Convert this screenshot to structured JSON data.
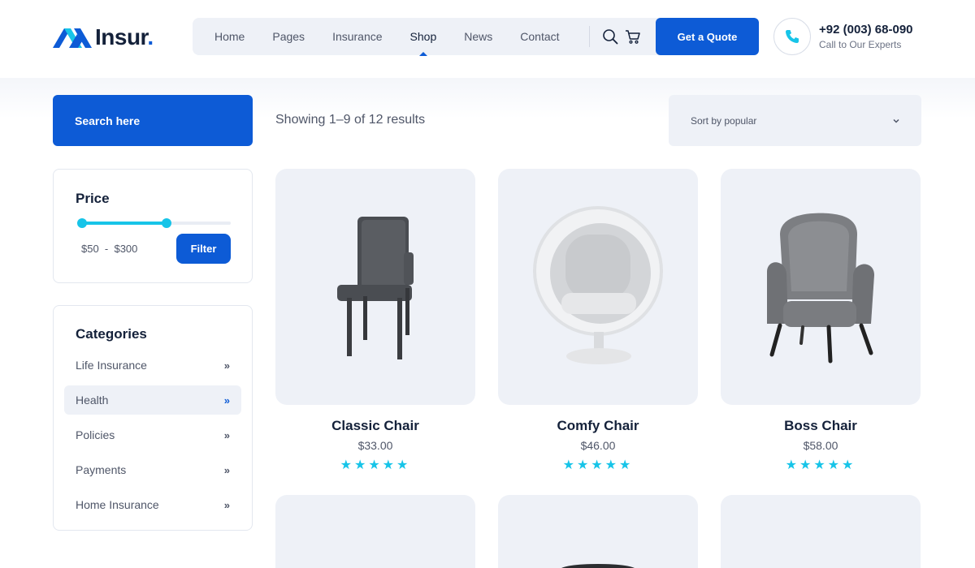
{
  "brand": {
    "name": "Insur",
    "dot": ".",
    "accent": "#0d5bd6"
  },
  "nav": {
    "items": [
      {
        "label": "Home"
      },
      {
        "label": "Pages"
      },
      {
        "label": "Insurance"
      },
      {
        "label": "Shop",
        "active": true
      },
      {
        "label": "News"
      },
      {
        "label": "Contact"
      }
    ],
    "icons": [
      "search-icon",
      "cart-icon"
    ],
    "cta_label": "Get a Quote"
  },
  "contact": {
    "phone": "+92 (003) 68-090",
    "caption": "Call to Our Experts",
    "icon": "phone-icon"
  },
  "sidebar": {
    "search_label": "Search here",
    "price": {
      "title": "Price",
      "range_text": "$50  -  $300",
      "slider_low": 0.0,
      "slider_high": 0.57,
      "filter_label": "Filter"
    },
    "categories": {
      "title": "Categories",
      "items": [
        {
          "label": "Life Insurance",
          "chevron": "»"
        },
        {
          "label": "Health",
          "chevron": "»",
          "active": true
        },
        {
          "label": "Policies",
          "chevron": "»"
        },
        {
          "label": "Payments",
          "chevron": "»"
        },
        {
          "label": "Home Insurance",
          "chevron": "»"
        }
      ]
    }
  },
  "shop": {
    "result_text": "Showing 1–9 of 12 results",
    "sort_label": "Sort by popular",
    "sort_icon": "chevron-down-icon",
    "products": [
      {
        "name": "Classic Chair",
        "price": "$33.00",
        "rating": 5,
        "stars": "★★★★★"
      },
      {
        "name": "Comfy Chair",
        "price": "$46.00",
        "rating": 5,
        "stars": "★★★★★"
      },
      {
        "name": "Boss Chair",
        "price": "$58.00",
        "rating": 5,
        "stars": "★★★★★"
      }
    ]
  },
  "colors": {
    "primary": "#0d5bd6",
    "cyan": "#17c4e8",
    "surface": "#eef1f7",
    "heading": "#14213a",
    "text": "#4f5668"
  }
}
